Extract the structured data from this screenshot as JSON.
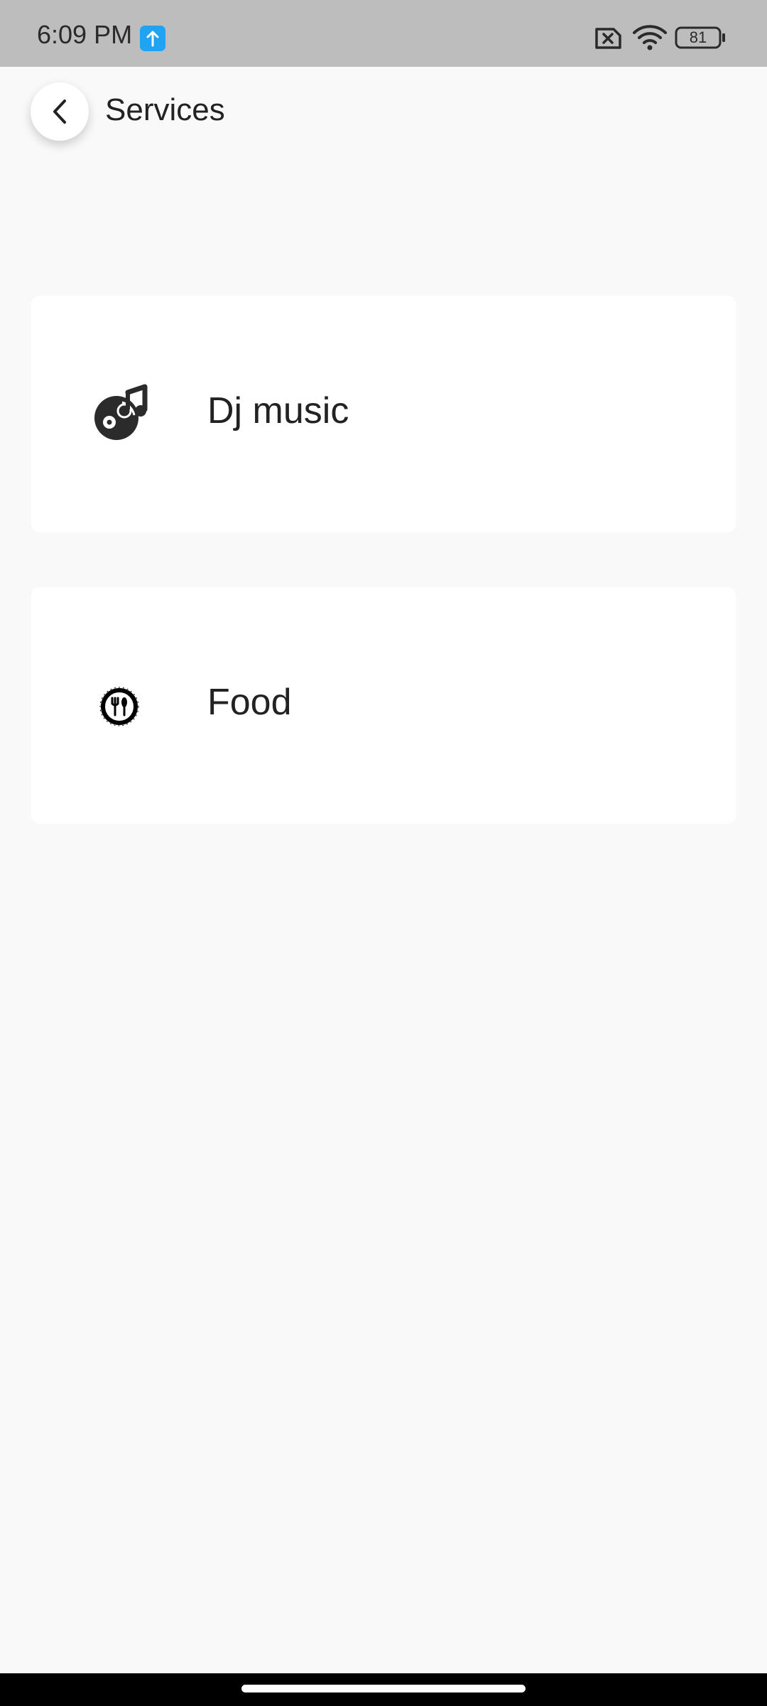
{
  "status_bar": {
    "time": "6:09 PM",
    "battery": "81",
    "icons": [
      "upload-notification-icon",
      "no-sim-icon",
      "wifi-icon",
      "battery-icon"
    ]
  },
  "header": {
    "title": "Services",
    "back_icon": "chevron-left-icon"
  },
  "services": [
    {
      "label": "Dj music",
      "icon": "dj-music-icon"
    },
    {
      "label": "Food",
      "icon": "food-icon"
    }
  ],
  "colors": {
    "status_bar_bg": "#bdbdbd",
    "page_bg": "#f9f9f9",
    "card_bg": "#ffffff",
    "accent_badge": "#20a3f3",
    "text": "#222222"
  }
}
